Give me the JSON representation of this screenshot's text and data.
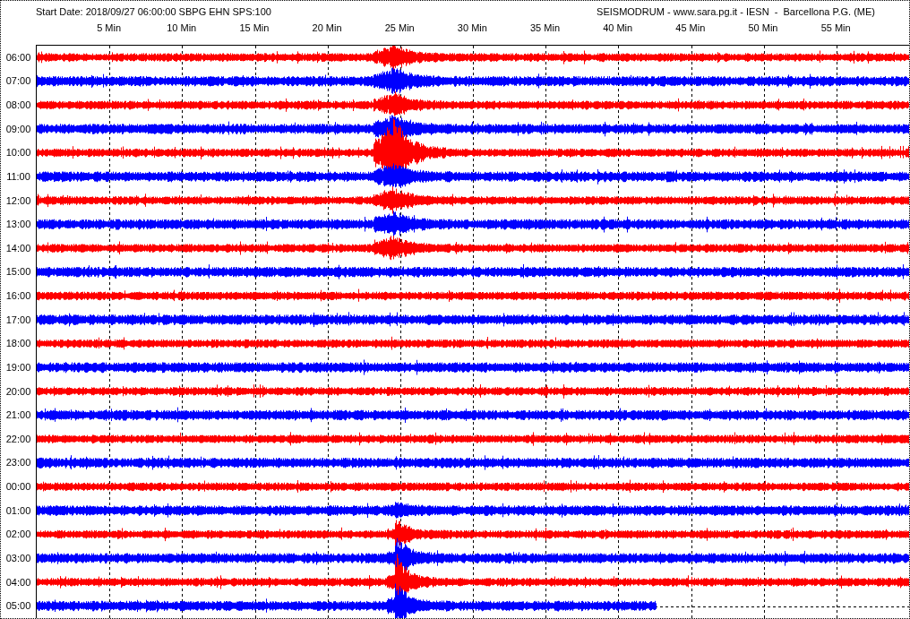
{
  "header": {
    "start_info": "Start Date: 2018/09/27 06:00:00 SBPG EHN SPS:100",
    "station": "SEISMODRUM - www.sara.pg.it - IESN  -  Barcellona P.G. (ME)"
  },
  "minute_labels": [
    "5 Min",
    "10 Min",
    "15 Min",
    "20 Min",
    "25 Min",
    "30 Min",
    "35 Min",
    "40 Min",
    "45 Min",
    "50 Min",
    "55 Min"
  ],
  "traces": [
    {
      "time": "06:00",
      "color": "#ff0000",
      "level": 1
    },
    {
      "time": "07:00",
      "color": "#0000ff",
      "level": 1
    },
    {
      "time": "08:00",
      "color": "#ff0000",
      "level": 1
    },
    {
      "time": "09:00",
      "color": "#0000ff",
      "level": 1
    },
    {
      "time": "10:00",
      "color": "#ff0000",
      "level": 1
    },
    {
      "time": "11:00",
      "color": "#0000ff",
      "level": 1
    },
    {
      "time": "12:00",
      "color": "#ff0000",
      "level": 1
    },
    {
      "time": "13:00",
      "color": "#0000ff",
      "level": 1
    },
    {
      "time": "14:00",
      "color": "#ff0000",
      "level": 1
    },
    {
      "time": "15:00",
      "color": "#0000ff",
      "level": 1
    },
    {
      "time": "16:00",
      "color": "#ff0000",
      "level": 1
    },
    {
      "time": "17:00",
      "color": "#0000ff",
      "level": 1
    },
    {
      "time": "18:00",
      "color": "#ff0000",
      "level": 1
    },
    {
      "time": "19:00",
      "color": "#0000ff",
      "level": 1
    },
    {
      "time": "20:00",
      "color": "#ff0000",
      "level": 1
    },
    {
      "time": "21:00",
      "color": "#0000ff",
      "level": 1
    },
    {
      "time": "22:00",
      "color": "#ff0000",
      "level": 1
    },
    {
      "time": "23:00",
      "color": "#0000ff",
      "level": 1
    },
    {
      "time": "00:00",
      "color": "#ff0000",
      "level": 1
    },
    {
      "time": "01:00",
      "color": "#0000ff",
      "level": 1
    },
    {
      "time": "02:00",
      "color": "#ff0000",
      "level": 1
    },
    {
      "time": "03:00",
      "color": "#0000ff",
      "level": 1
    },
    {
      "time": "04:00",
      "color": "#ff0000",
      "level": 1
    },
    {
      "time": "05:00",
      "color": "#0000ff",
      "level": 0.71
    }
  ]
}
